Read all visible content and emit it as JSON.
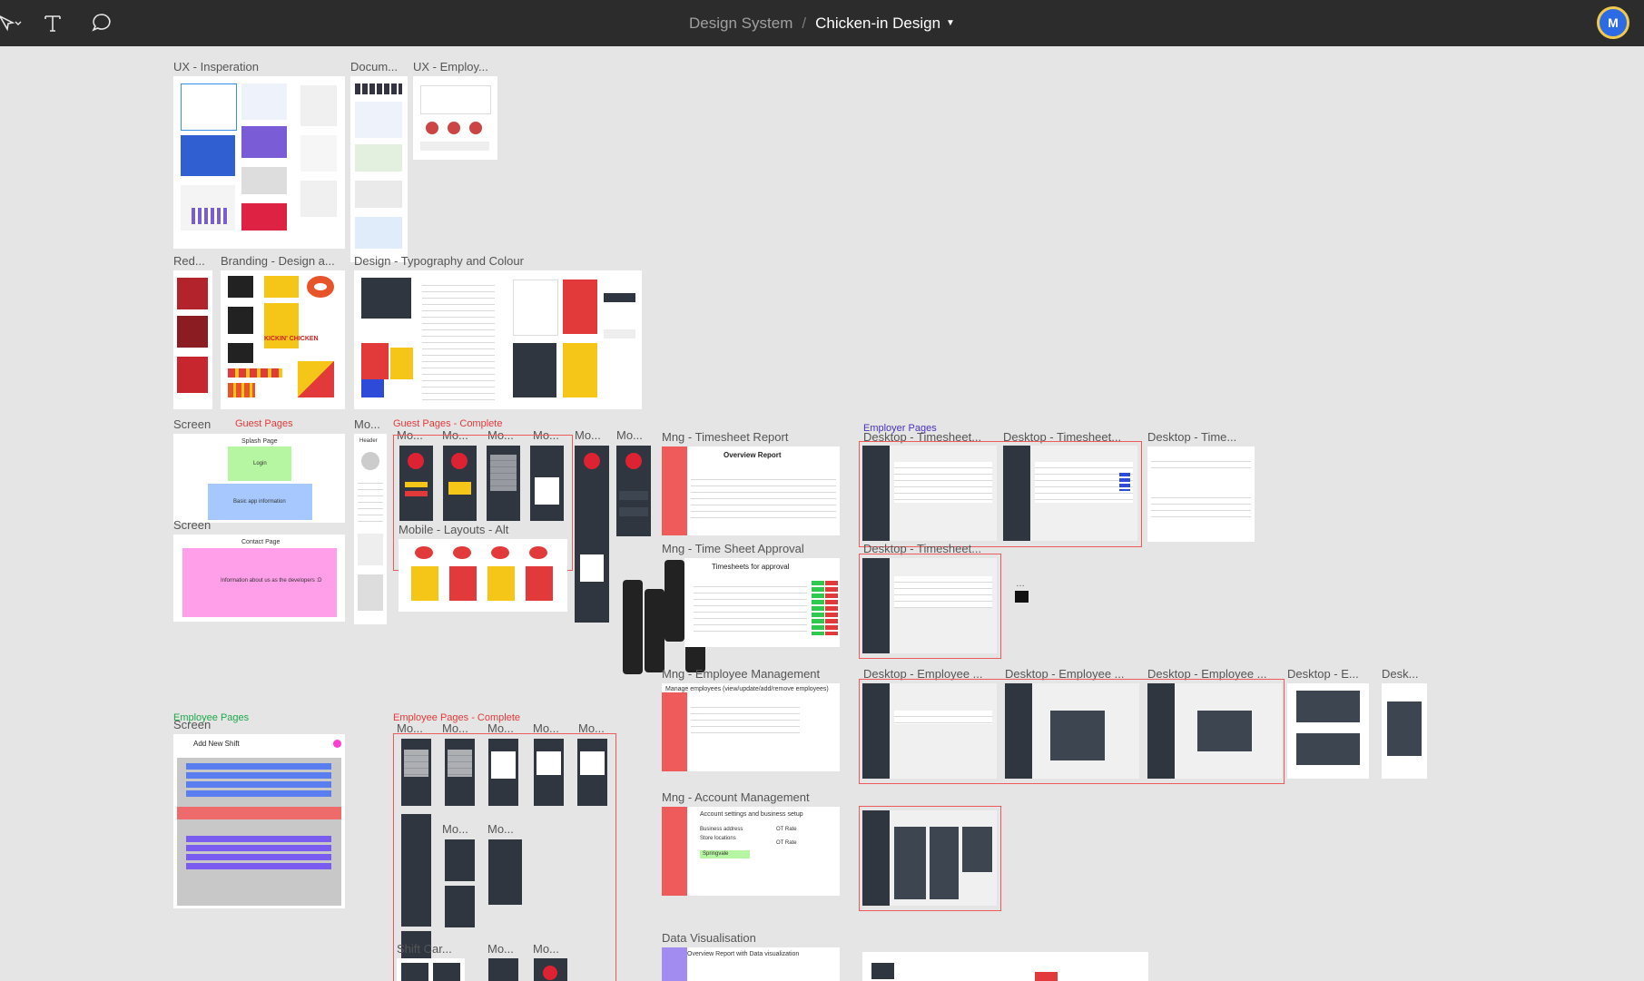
{
  "app": {
    "project": "Design System",
    "file": "Chicken-in Design",
    "user_initial": "M"
  },
  "toolbar": {
    "tools": [
      "move-tool",
      "text-tool",
      "comment-tool"
    ]
  },
  "colors": {
    "topbar": "#2c2c2c",
    "canvas": "#e5e5e5",
    "selection": "#ef5b5b",
    "brand_red": "#e23a3a",
    "brand_yellow": "#f5c518",
    "dark_panel": "#2f3640"
  },
  "frames": {
    "ux_insp": "UX - Insperation",
    "docum": "Docum...",
    "ux_employ": "UX - Employ...",
    "red": "Red...",
    "branding": "Branding - Design a...",
    "typography": "Design - Typography and Colour",
    "screen1": "Screen",
    "screen2": "Screen",
    "screen3": "Screen",
    "mo_a": "Mo...",
    "mo_b": "Mo...",
    "mo_c": "Mo...",
    "mo_d": "Mo...",
    "mo_e": "Mo...",
    "mo_f": "Mo...",
    "mo_g": "Mo...",
    "mobile_layouts_alt": "Mobile - Layouts - Alt",
    "mng_timesheet_report": "Mng - Timesheet Report",
    "mng_timesheet_approval": "Mng - Time Sheet Approval",
    "mng_employee_mgmt": "Mng - Employee Management",
    "mng_account_mgmt": "Mng - Account Management",
    "data_vis": "Data Visualisation",
    "desk_ts1": "Desktop - Timesheet...",
    "desk_ts2": "Desktop - Timesheet...",
    "desk_ts3": "Desktop - Time...",
    "desk_ts4": "Desktop - Timesheet...",
    "desk_emp1": "Desktop - Employee ...",
    "desk_emp2": "Desktop - Employee ...",
    "desk_emp3": "Desktop - Employee ...",
    "desk_e": "Desktop - E...",
    "desk_short": "Desk...",
    "emp_mo1": "Mo...",
    "emp_mo2": "Mo...",
    "emp_mo3": "Mo...",
    "emp_mo4": "Mo...",
    "emp_mo5": "Mo...",
    "emp_mo6": "Mo...",
    "shift_car": "Shift Car...",
    "emp_mo7": "Mo...",
    "emp_mo8": "Mo..."
  },
  "section_labels": {
    "guest_pages": "Guest Pages",
    "guest_complete": "Guest Pages - Complete",
    "employer_pages": "Employer Pages",
    "employee_pages": "Employee Pages",
    "employee_complete": "Employee Pages - Complete"
  },
  "thumb_text": {
    "splash": "Splash Page",
    "login": "Login",
    "basic_info": "Basic app information",
    "contact": "Contact Page",
    "contact_info": "Information about us as the developers :D",
    "header": "Header",
    "overview_report": "Overview Report",
    "timesheets_for_approval": "Timesheets for approval",
    "manage_employees": "Manage employees (view/update/add/remove employees)",
    "account_settings": "Account settings and business setup",
    "overview_data_vis": "Overview Report with Data visualization",
    "add_new_shift": "Add New Shift",
    "business_address": "Business address",
    "store_locations": "Store locations",
    "ot_rate": "OT Rate",
    "springvale": "Springvale",
    "kickin_chicken": "KICKIN' CHICKEN"
  }
}
